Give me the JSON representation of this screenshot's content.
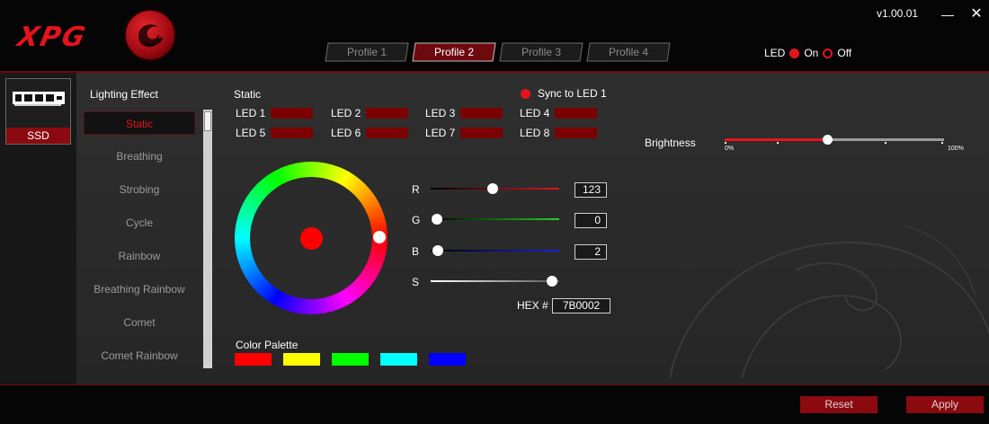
{
  "header": {
    "logo_text": "XPG",
    "version": "v1.00.01",
    "minimize_glyph": "—",
    "close_glyph": "✕"
  },
  "profiles": [
    {
      "label": "Profile 1",
      "active": false
    },
    {
      "label": "Profile 2",
      "active": true
    },
    {
      "label": "Profile 3",
      "active": false
    },
    {
      "label": "Profile 4",
      "active": false
    }
  ],
  "led_toggle": {
    "label": "LED",
    "on_label": "On",
    "off_label": "Off",
    "state": "on"
  },
  "device": {
    "label": "SSD",
    "icon": "ssd-icon"
  },
  "lighting": {
    "title": "Lighting Effect",
    "effects": [
      "Static",
      "Breathing",
      "Strobing",
      "Cycle",
      "Rainbow",
      "Breathing Rainbow",
      "Comet",
      "Comet Rainbow"
    ],
    "selected": "Static"
  },
  "static_panel": {
    "title": "Static",
    "sync_label": "Sync to LED 1",
    "leds": [
      {
        "label": "LED 1",
        "color": "#7B0002"
      },
      {
        "label": "LED 2",
        "color": "#7B0002"
      },
      {
        "label": "LED 3",
        "color": "#7B0002"
      },
      {
        "label": "LED 4",
        "color": "#7B0002"
      },
      {
        "label": "LED 5",
        "color": "#7B0002"
      },
      {
        "label": "LED 6",
        "color": "#7B0002"
      },
      {
        "label": "LED 7",
        "color": "#7B0002"
      },
      {
        "label": "LED 8",
        "color": "#7B0002"
      }
    ]
  },
  "color": {
    "r_label": "R",
    "r_value": "123",
    "g_label": "G",
    "g_value": "0",
    "b_label": "B",
    "b_value": "2",
    "s_label": "S",
    "hex_label": "HEX #",
    "hex_value": "7B0002",
    "saturation_level": 0.95
  },
  "palette": {
    "title": "Color Palette",
    "colors": [
      "#FF0000",
      "#FFFF00",
      "#00FF00",
      "#00FFFF",
      "#0000FF"
    ]
  },
  "brightness": {
    "label": "Brightness",
    "min_label": "0%",
    "max_label": "100%",
    "level": 0.47
  },
  "footer": {
    "reset_label": "Reset",
    "apply_label": "Apply"
  },
  "colors": {
    "accent": "#E3141E",
    "dark_red": "#8B0A10",
    "led_color": "#7B0002"
  }
}
